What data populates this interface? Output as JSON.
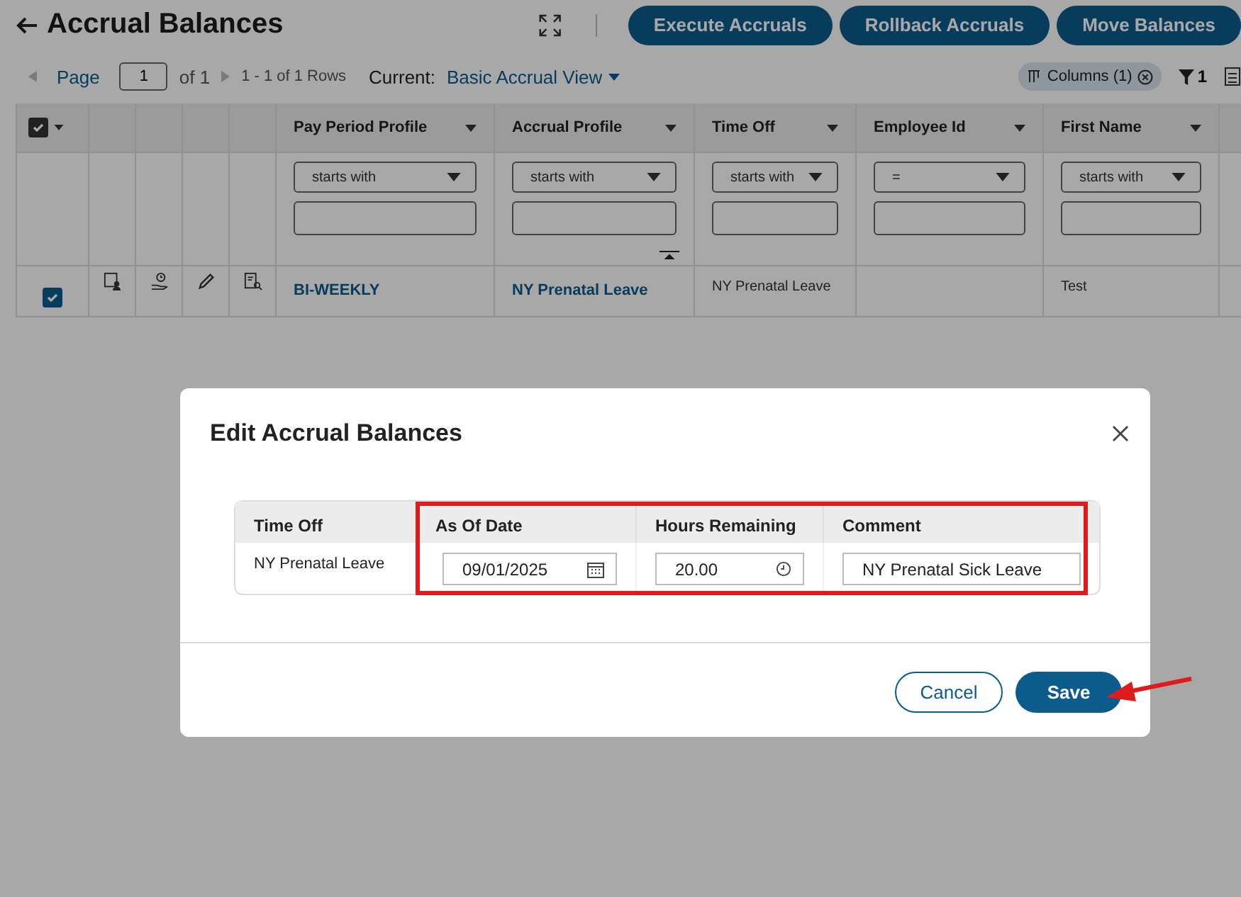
{
  "header": {
    "title": "Accrual Balances",
    "buttons": [
      "Execute Accruals",
      "Rollback Accruals",
      "Move Balances"
    ]
  },
  "toolbar": {
    "page_label": "Page",
    "page_value": "1",
    "page_of": "of 1",
    "rows_info": "1 - 1 of 1 Rows",
    "current_label": "Current:",
    "view": "Basic Accrual View",
    "columns_chip": "Columns (1)",
    "filter_count": "1"
  },
  "table": {
    "select_all_checked": true,
    "columns": [
      {
        "label": "Pay Period Profile",
        "filter_operator": "starts with"
      },
      {
        "label": "Accrual Profile",
        "filter_operator": "starts with"
      },
      {
        "label": "Time Off",
        "filter_operator": "starts with"
      },
      {
        "label": "Employee Id",
        "filter_operator": "="
      },
      {
        "label": "First Name",
        "filter_operator": "starts with"
      }
    ],
    "rows": [
      {
        "checked": true,
        "cells": [
          {
            "kind": "link",
            "text": "BI-WEEKLY"
          },
          {
            "kind": "link",
            "text": "NY Prenatal Leave"
          },
          {
            "kind": "text",
            "text": "NY Prenatal Leave"
          },
          {
            "kind": "text",
            "text": ""
          },
          {
            "kind": "text",
            "text": "Test"
          }
        ]
      }
    ]
  },
  "modal": {
    "title": "Edit Accrual Balances",
    "columns": [
      "Time Off",
      "As Of Date",
      "Hours Remaining",
      "Comment"
    ],
    "rows": [
      {
        "time_off": "NY Prenatal Leave",
        "as_of_date": "09/01/2025",
        "hours_remaining": "20.00",
        "comment": "NY Prenatal Sick Leave"
      }
    ],
    "cancel": "Cancel",
    "save": "Save"
  }
}
